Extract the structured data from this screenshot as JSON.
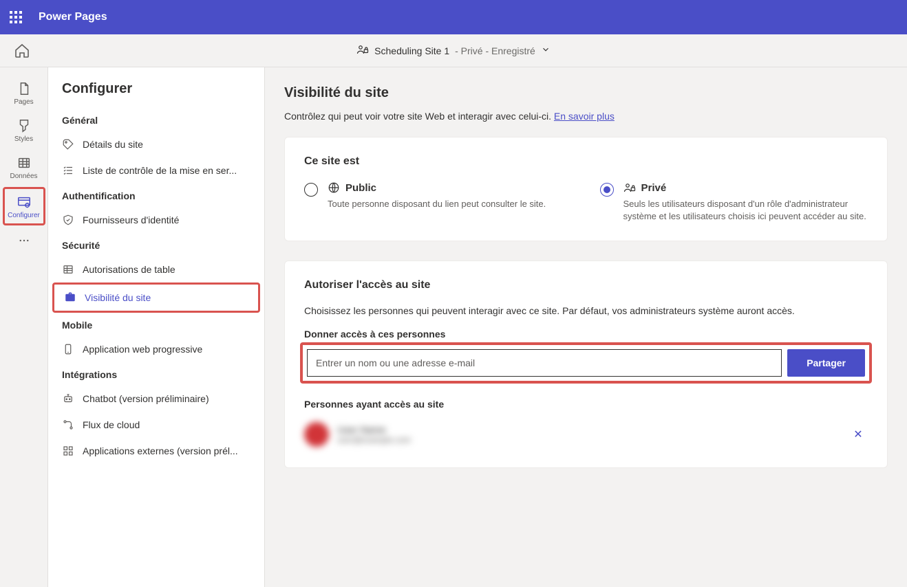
{
  "brand": "Power Pages",
  "site": {
    "name": "Scheduling Site 1",
    "meta": "- Privé - Enregistré"
  },
  "rail": {
    "pages": "Pages",
    "styles": "Styles",
    "data": "Données",
    "setup": "Configurer"
  },
  "panel_title": "Configurer",
  "sections": {
    "general": "Général",
    "auth": "Authentification",
    "security": "Sécurité",
    "mobile": "Mobile",
    "integrations": "Intégrations"
  },
  "nav": {
    "site_details": "Détails du site",
    "golive_checklist": "Liste de contrôle de la mise en ser...",
    "identity_providers": "Fournisseurs d'identité",
    "table_permissions": "Autorisations de table",
    "site_visibility": "Visibilité du site",
    "pwa": "Application web progressive",
    "chatbot": "Chatbot (version préliminaire)",
    "cloud_flows": "Flux de cloud",
    "external_apps": "Applications externes (version prél..."
  },
  "main": {
    "title": "Visibilité du site",
    "subtitle_prefix": "Contrôlez qui peut voir votre site Web et interagir avec celui-ci. ",
    "learn_more": "En savoir plus",
    "card1_title": "Ce site est",
    "public_label": "Public",
    "public_desc": "Toute personne disposant du lien peut consulter le site.",
    "private_label": "Privé",
    "private_desc": "Seuls les utilisateurs disposant d'un rôle d'administrateur système et les utilisateurs choisis ici peuvent accéder au site.",
    "card2_title": "Autoriser l'accès au site",
    "card2_desc": "Choisissez les personnes qui peuvent interagir avec ce site. Par défaut, vos administrateurs système auront accès.",
    "share_label": "Donner accès à ces personnes",
    "share_placeholder": "Entrer un nom ou une adresse e-mail",
    "share_button": "Partager",
    "people_title": "Personnes ayant accès au site",
    "person_name": "User Name",
    "person_sub": "user@example.com"
  }
}
